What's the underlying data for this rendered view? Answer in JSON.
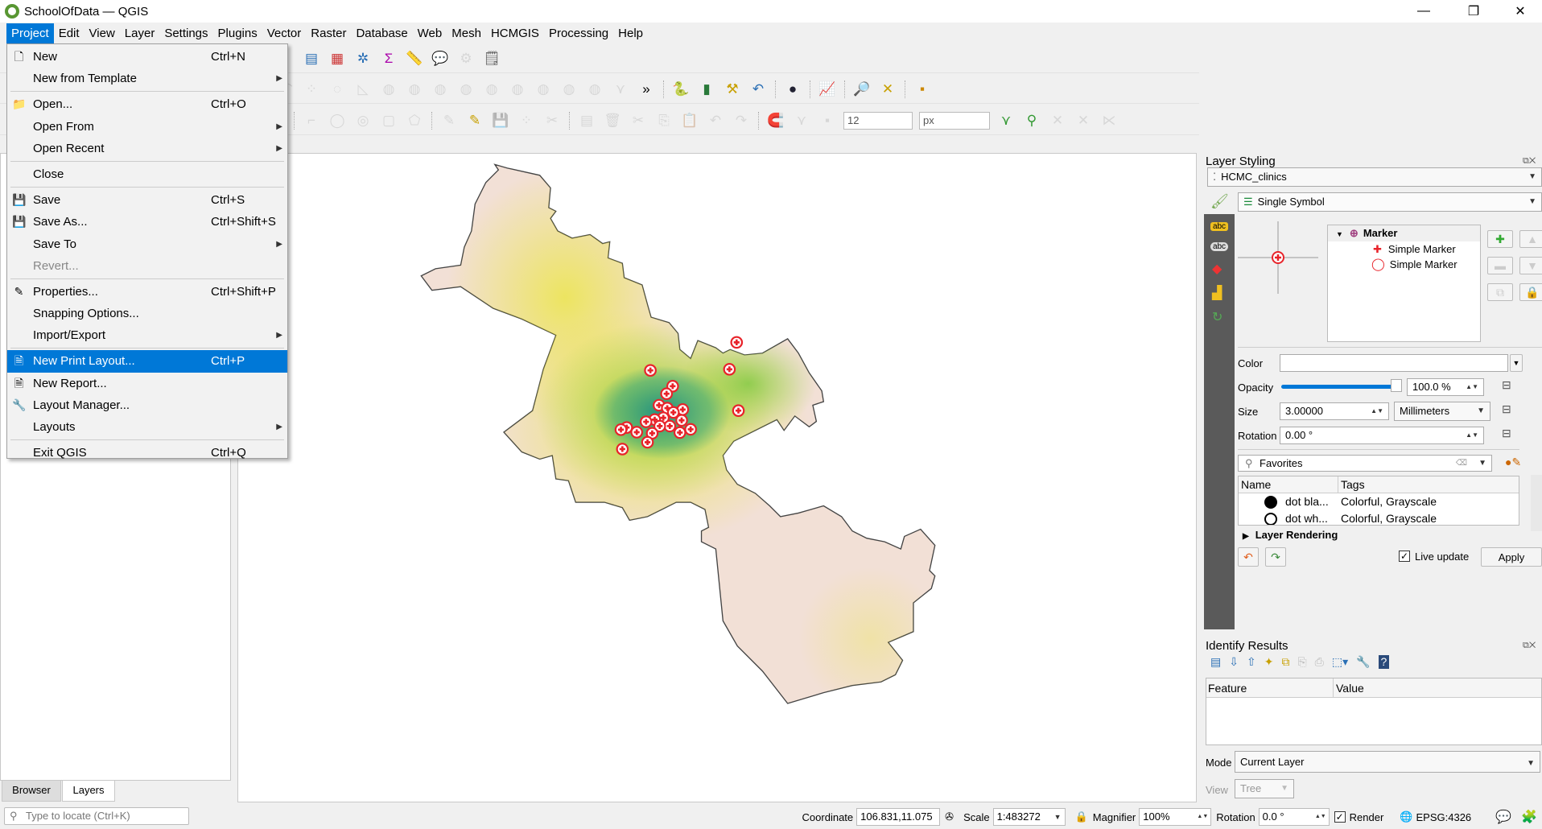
{
  "window": {
    "title": "SchoolOfData — QGIS",
    "minimize": "—",
    "maximize": "❐",
    "close": "✕"
  },
  "menubar": [
    "Project",
    "Edit",
    "View",
    "Layer",
    "Settings",
    "Plugins",
    "Vector",
    "Raster",
    "Database",
    "Web",
    "Mesh",
    "HCMGIS",
    "Processing",
    "Help"
  ],
  "project_menu": [
    {
      "label": "New",
      "shortcut": "Ctrl+N",
      "icon": "new-file-icon",
      "glyph": "🗋"
    },
    {
      "label": "New from Template",
      "submenu": true
    },
    {
      "sep": true
    },
    {
      "label": "Open...",
      "shortcut": "Ctrl+O",
      "icon": "folder-icon",
      "glyph": "📁"
    },
    {
      "label": "Open From",
      "submenu": true
    },
    {
      "label": "Open Recent",
      "submenu": true
    },
    {
      "sep": true
    },
    {
      "label": "Close"
    },
    {
      "sep": true
    },
    {
      "label": "Save",
      "shortcut": "Ctrl+S",
      "icon": "save-icon",
      "glyph": "💾"
    },
    {
      "label": "Save As...",
      "shortcut": "Ctrl+Shift+S",
      "icon": "save-as-icon",
      "glyph": "💾"
    },
    {
      "label": "Save To",
      "submenu": true
    },
    {
      "label": "Revert...",
      "disabled": true
    },
    {
      "sep": true
    },
    {
      "label": "Properties...",
      "shortcut": "Ctrl+Shift+P",
      "icon": "pencil-icon",
      "glyph": "✎"
    },
    {
      "label": "Snapping Options..."
    },
    {
      "label": "Import/Export",
      "submenu": true
    },
    {
      "sep": true
    },
    {
      "label": "New Print Layout...",
      "shortcut": "Ctrl+P",
      "icon": "print-layout-icon",
      "glyph": "🗎",
      "highlighted": true
    },
    {
      "label": "New Report...",
      "icon": "report-icon",
      "glyph": "🗎"
    },
    {
      "label": "Layout Manager...",
      "icon": "layout-manager-icon",
      "glyph": "🔧"
    },
    {
      "label": "Layouts",
      "submenu": true
    },
    {
      "sep": true
    },
    {
      "label": "Exit QGIS",
      "shortcut": "Ctrl+Q"
    }
  ],
  "toolbars": {
    "row1": [
      [
        "pan-map-icon",
        "✥",
        "#2a6fb5"
      ],
      [
        "zoom-in-icon",
        "🔍",
        "#555"
      ],
      [
        "zoom-out-icon",
        "🔍",
        "#555"
      ],
      [
        "zoom-native-icon",
        "⊡",
        "#999"
      ],
      [
        "zoom-full-icon",
        "🔍",
        "#555"
      ],
      [
        "zoom-layer-icon",
        "🔍",
        "#999"
      ],
      [
        "new-bookmark-icon",
        "🔖",
        "#c8a000"
      ],
      [
        "show-bookmarks-icon",
        "🗂",
        "#c8a000"
      ],
      [
        "temporal-icon",
        "🕓",
        "#555"
      ],
      [
        "refresh-icon",
        "⟳",
        "#2a6fb5"
      ],
      [
        "sep"
      ],
      [
        "identify-icon",
        "ℹ",
        "#2a6fb5"
      ],
      [
        "attribute-table-icon",
        "▤",
        "#2a6fb5"
      ],
      [
        "statistics-icon",
        "▦",
        "#c33"
      ],
      [
        "settings-icon",
        "✲",
        "#2a6fb5"
      ],
      [
        "sum-icon",
        "Σ",
        "#a0a"
      ],
      [
        "measure-icon",
        "📏",
        "#555"
      ],
      [
        "map-tips-icon",
        "💬",
        "#c8c800"
      ],
      [
        "select-icon",
        "⚙",
        "#aaa"
      ],
      [
        "annotation-icon",
        "🗒",
        "#555"
      ]
    ],
    "row2": [
      [
        "digitize-icon",
        "✎",
        "#aaa"
      ],
      [
        "digitize-icon",
        "✎",
        "#aaa"
      ],
      [
        "digitize-icon",
        "✎",
        "#aaa"
      ],
      [
        "digitize-icon",
        "✎",
        "#aaa"
      ],
      [
        "digitize-icon",
        "✎",
        "#aaa"
      ],
      [
        "digitize-icon",
        "✎",
        "#aaa"
      ],
      [
        "digitize-icon",
        "✎",
        "#aaa"
      ],
      [
        "digitize-icon",
        "✎",
        "#aaa"
      ],
      [
        "globe-green-icon",
        "◐",
        "#2a9a3a"
      ],
      [
        "triangle-icon",
        "▲",
        "#7a2"
      ],
      [
        "sep"
      ],
      [
        "add-ring-icon",
        "⌒",
        "#aaa"
      ],
      [
        "add-part-icon",
        "⁘",
        "#aaa"
      ],
      [
        "fill-ring-icon",
        "◌",
        "#aaa"
      ],
      [
        "ruler-icon",
        "◺",
        "#aaa"
      ],
      [
        "reshape-icon",
        "◍",
        "#aaa"
      ],
      [
        "offset-icon",
        "◍",
        "#aaa"
      ],
      [
        "merge-icon",
        "◍",
        "#aaa"
      ],
      [
        "merge-icon",
        "◍",
        "#aaa"
      ],
      [
        "split-icon",
        "◍",
        "#aaa"
      ],
      [
        "split-icon",
        "◍",
        "#aaa"
      ],
      [
        "delete-part-icon",
        "◍",
        "#aaa"
      ],
      [
        "rotate-icon",
        "◍",
        "#aaa"
      ],
      [
        "simplify-icon",
        "◍",
        "#aaa"
      ],
      [
        "vertex-icon",
        "⋎",
        "#aaa"
      ],
      [
        "more-icon",
        "»",
        "#000"
      ],
      [
        "sep"
      ],
      [
        "python-icon",
        "🐍",
        "#3a6"
      ],
      [
        "plugin-icon",
        "▮",
        "#2a7a3a"
      ],
      [
        "wand-icon",
        "⚒",
        "#c8a000"
      ],
      [
        "undo-icon",
        "↶",
        "#2a6fb5"
      ],
      [
        "sep"
      ],
      [
        "globe-icon",
        "●",
        "#223"
      ],
      [
        "sep"
      ],
      [
        "graph-icon",
        "📈",
        "#c33"
      ],
      [
        "sep"
      ],
      [
        "zoom-green-icon",
        "🔎",
        "#3a3"
      ],
      [
        "hcmgis-icon",
        "✕",
        "#c8a000"
      ],
      [
        "sep"
      ],
      [
        "chart-icon",
        "▪",
        "#c80"
      ]
    ],
    "row3": [
      [
        "digitize-icon",
        "✎",
        "#aaa"
      ],
      [
        "digitize-icon",
        "✎",
        "#aaa"
      ],
      [
        "digitize-icon",
        "✎",
        "#aaa"
      ],
      [
        "digitize-icon",
        "✎",
        "#aaa"
      ],
      [
        "digitize-icon",
        "✎",
        "#aaa"
      ],
      [
        "digitize-icon",
        "✎",
        "#aaa"
      ],
      [
        "digitize-icon",
        "✎",
        "#aaa"
      ],
      [
        "digitize-icon",
        "✎",
        "#aaa"
      ],
      [
        "select-features-icon",
        "☰",
        "#c8a800"
      ],
      [
        "deselect-icon",
        "⧉",
        "#c80"
      ],
      [
        "select-location-icon",
        "▮",
        "#c8a800"
      ],
      [
        "sep"
      ],
      [
        "shape-icon",
        "⌐",
        "#aaa"
      ],
      [
        "circle-icon",
        "◯",
        "#aaa"
      ],
      [
        "ellipse-icon",
        "◎",
        "#aaa"
      ],
      [
        "rectangle-icon",
        "▢",
        "#aaa"
      ],
      [
        "polygon-icon",
        "⬠",
        "#aaa"
      ],
      [
        "sep"
      ],
      [
        "edit-icon",
        "✎",
        "#aaa"
      ],
      [
        "toggle-edit-icon",
        "✎",
        "#c8a000"
      ],
      [
        "save-edits-icon",
        "💾",
        "#aaa"
      ],
      [
        "add-feature-icon",
        "⁘",
        "#aaa"
      ],
      [
        "vertex-tool-icon",
        "✂",
        "#aaa"
      ],
      [
        "sep"
      ],
      [
        "modify-icon",
        "▤",
        "#aaa"
      ],
      [
        "delete-icon",
        "🗑",
        "#aaa"
      ],
      [
        "cut-icon",
        "✂",
        "#aaa"
      ],
      [
        "copy-icon",
        "⎘",
        "#aaa"
      ],
      [
        "paste-icon",
        "📋",
        "#aaa"
      ],
      [
        "undo-icon",
        "↶",
        "#aaa"
      ],
      [
        "redo-icon",
        "↷",
        "#aaa"
      ],
      [
        "sep"
      ],
      [
        "magnet-icon",
        "🧲",
        "#c33"
      ],
      [
        "snap-icon",
        "⋎",
        "#aaa"
      ],
      [
        "snap-type-icon",
        "▪",
        "#aaa"
      ],
      [
        "tolerance-spinbox"
      ],
      [
        "units-combo"
      ],
      [
        "trace-icon",
        "⋎",
        "#393"
      ],
      [
        "snap-layer-icon",
        "⚲",
        "#393"
      ],
      [
        "remove-icon",
        "✕",
        "#aaa"
      ],
      [
        "split-icon",
        "✕",
        "#aaa"
      ],
      [
        "avoid-icon",
        "⋉",
        "#aaa"
      ]
    ],
    "tolerance": "12",
    "units": "px"
  },
  "left_tabs": {
    "browser": "Browser",
    "layers": "Layers"
  },
  "locate": {
    "placeholder": "Type to locate (Ctrl+K)"
  },
  "layer_styling": {
    "title": "Layer Styling",
    "layer": "HCMC_clinics",
    "renderer": "Single Symbol",
    "tree": {
      "root": "Marker",
      "children": [
        "Simple Marker",
        "Simple Marker"
      ]
    },
    "color_label": "Color",
    "opacity_label": "Opacity",
    "opacity": 100.0,
    "opacity_value": "100.0 %",
    "size_label": "Size",
    "size_value": "3.00000",
    "size_unit": "Millimeters",
    "rotation_label": "Rotation",
    "rotation_value": "0.00 °",
    "search": "Favorites",
    "table_headers": [
      "Name",
      "Tags"
    ],
    "symbols": [
      {
        "name": "dot  bla...",
        "tags": "Colorful, Grayscale"
      },
      {
        "name": "dot  wh...",
        "tags": "Colorful, Grayscale"
      }
    ],
    "layer_rendering": "Layer Rendering",
    "live_update": "Live update",
    "live_update_checked": true,
    "apply": "Apply"
  },
  "identify": {
    "title": "Identify Results",
    "headers": [
      "Feature",
      "Value"
    ],
    "mode_label": "Mode",
    "mode": "Current Layer",
    "view_label": "View",
    "view": "Tree"
  },
  "status": {
    "coordinate_label": "Coordinate",
    "coordinate": "106.831,11.075",
    "scale_label": "Scale",
    "scale": "1:483272",
    "magnifier_label": "Magnifier",
    "magnifier": "100%",
    "rotation_label": "Rotation",
    "rotation": "0.0 °",
    "render_label": "Render",
    "render_checked": true,
    "crs": "EPSG:4326"
  },
  "colors": {
    "accent": "#0078d7",
    "polygon_fill": "#f2e0d6",
    "clinic_marker": "#e8232a"
  }
}
